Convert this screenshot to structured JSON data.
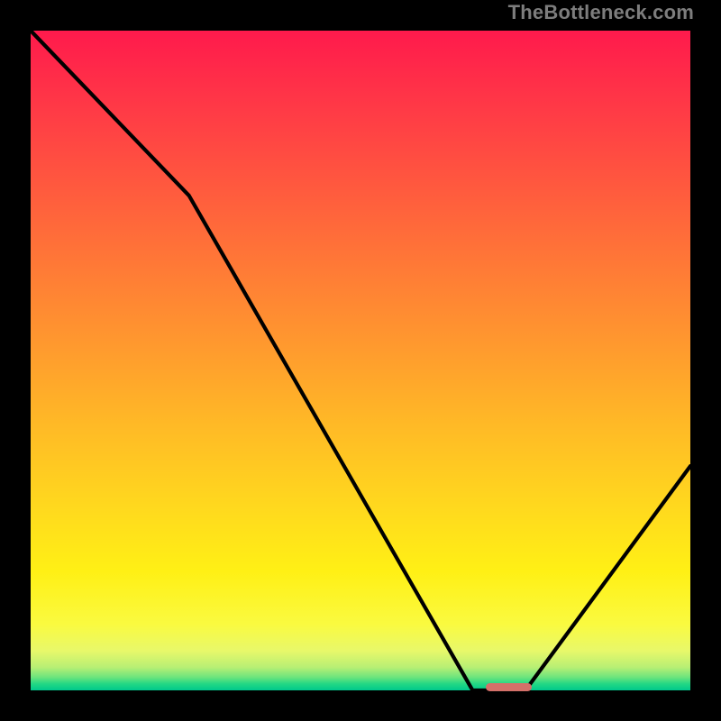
{
  "watermark": {
    "text": "TheBottleneck.com"
  },
  "chart_data": {
    "type": "line",
    "title": "",
    "xlabel": "",
    "ylabel": "",
    "xlim": [
      0,
      100
    ],
    "ylim": [
      0,
      100
    ],
    "x": [
      0,
      24,
      67,
      75,
      100
    ],
    "values": [
      100,
      75,
      0,
      0,
      34
    ],
    "gradient_stops": [
      {
        "pct": 0,
        "color": "#ff1a4c"
      },
      {
        "pct": 12,
        "color": "#ff3a46"
      },
      {
        "pct": 24,
        "color": "#ff5a3e"
      },
      {
        "pct": 36,
        "color": "#ff7a36"
      },
      {
        "pct": 48,
        "color": "#ff9a2e"
      },
      {
        "pct": 60,
        "color": "#ffba26"
      },
      {
        "pct": 72,
        "color": "#ffd81e"
      },
      {
        "pct": 82,
        "color": "#fff015"
      },
      {
        "pct": 90,
        "color": "#fafa40"
      },
      {
        "pct": 94,
        "color": "#e8f86a"
      },
      {
        "pct": 96.5,
        "color": "#b8ef74"
      },
      {
        "pct": 98,
        "color": "#6de47d"
      },
      {
        "pct": 99,
        "color": "#24d884"
      },
      {
        "pct": 100,
        "color": "#00c88c"
      }
    ],
    "marker": {
      "x_start": 69,
      "x_end": 76,
      "y": 0,
      "color": "#d47069"
    }
  }
}
